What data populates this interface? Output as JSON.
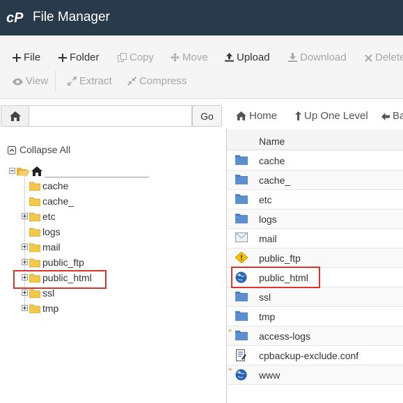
{
  "header": {
    "title": "File Manager",
    "logo": "cP"
  },
  "toolbar": {
    "file": "File",
    "folder": "Folder",
    "copy": "Copy",
    "move": "Move",
    "upload": "Upload",
    "download": "Download",
    "delete": "Delete",
    "view": "View",
    "extract": "Extract",
    "compress": "Compress"
  },
  "pathbar": {
    "value": "",
    "go": "Go"
  },
  "nav": {
    "home": "Home",
    "up": "Up One Level",
    "back": "Back"
  },
  "tree": {
    "collapse_all": "Collapse All",
    "items": [
      "cache",
      "cache_",
      "etc",
      "logs",
      "mail",
      "public_ftp",
      "public_html",
      "ssl",
      "tmp"
    ]
  },
  "list": {
    "column_name": "Name",
    "rows": [
      "cache",
      "cache_",
      "etc",
      "logs",
      "mail",
      "public_ftp",
      "public_html",
      "ssl",
      "tmp",
      "access-logs",
      "cpbackup-exclude.conf",
      "www"
    ]
  },
  "colors": {
    "header_bg": "#293a4a",
    "highlight": "#d9332b",
    "folder": "#f2c94c"
  }
}
